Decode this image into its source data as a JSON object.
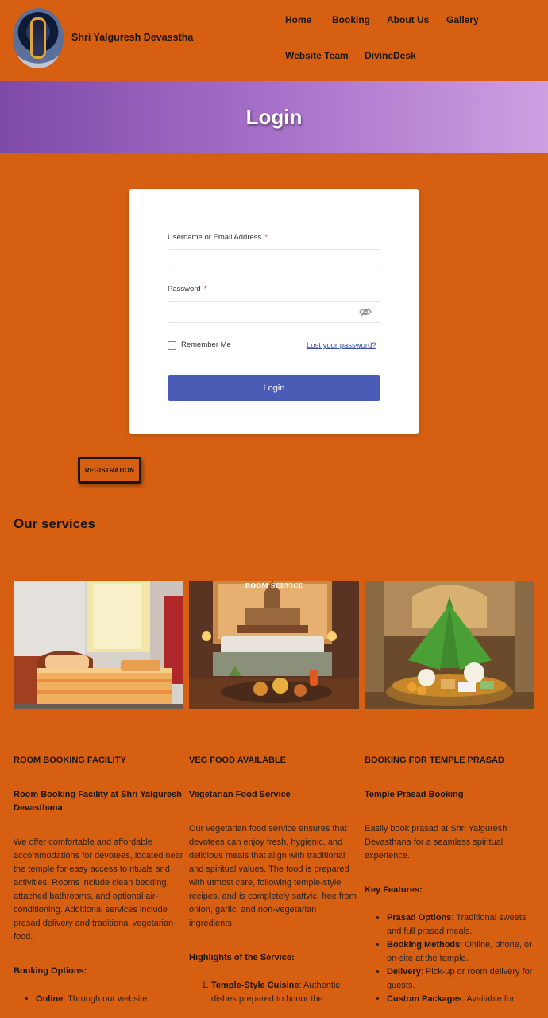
{
  "site": {
    "title": "Shri Yalguresh Devasstha"
  },
  "nav": {
    "home": "Home",
    "booking": "Booking",
    "about": "About Us",
    "gallery": "Gallery",
    "team": "Website Team",
    "divinedesk": "DivineDesk"
  },
  "banner": {
    "title": "Login"
  },
  "login": {
    "username_label": "Username or Email Address",
    "password_label": "Password",
    "required_mark": "*",
    "username_value": "",
    "password_value": "",
    "remember_label": "Remember Me",
    "lost_password": "Lost your password?",
    "submit_label": "Login"
  },
  "registration": {
    "label": "REGISTRATION"
  },
  "services": {
    "title": "Our services",
    "room_image_text": "ROOM SERVICE",
    "room": {
      "heading": "ROOM BOOKING FACILITY",
      "subheading": "Room Booking Facility at Shri Yalguresh Devasthana",
      "body": "We offer comfortable and affordable accommodations for devotees, located near the temple for easy access to rituals and activities. Rooms include clean bedding, attached bathrooms, and optional air-conditioning. Additional services include prasad delivery and traditional vegetarian food.",
      "options_heading": "Booking Options:",
      "option1_label": "Online",
      "option1_text": ": Through our website"
    },
    "food": {
      "heading": "VEG FOOD AVAILABLE",
      "subheading": "Vegetarian Food Service",
      "body": "Our vegetarian food service ensures that devotees can enjoy fresh, hygienic, and delicious meals that align with traditional and spiritual values. The food is prepared with utmost care, following temple-style recipes, and is completely sattvic, free from onion, garlic, and non-vegetarian ingredients.",
      "highlights_heading": "Highlights of the Service:",
      "item1_label": "Temple-Style Cuisine",
      "item1_text": ": Authentic dishes prepared to honor the"
    },
    "prasad": {
      "heading": "BOOKING FOR TEMPLE PRASAD",
      "subheading": "Temple Prasad Booking",
      "body": "Easily book prasad at Shri Yalguresh Devasthana for a seamless spiritual experience.",
      "features_heading": "Key Features:",
      "f1_label": "Prasad Options",
      "f1_text": ": Traditional sweets and full prasad meals.",
      "f2_label": "Booking Methods",
      "f2_text": ": Online, phone, or on-site at the temple.",
      "f3_label": "Delivery",
      "f3_text": ": Pick-up or room delivery for guests.",
      "f4_label": "Custom Packages",
      "f4_text": ": Available for"
    }
  }
}
